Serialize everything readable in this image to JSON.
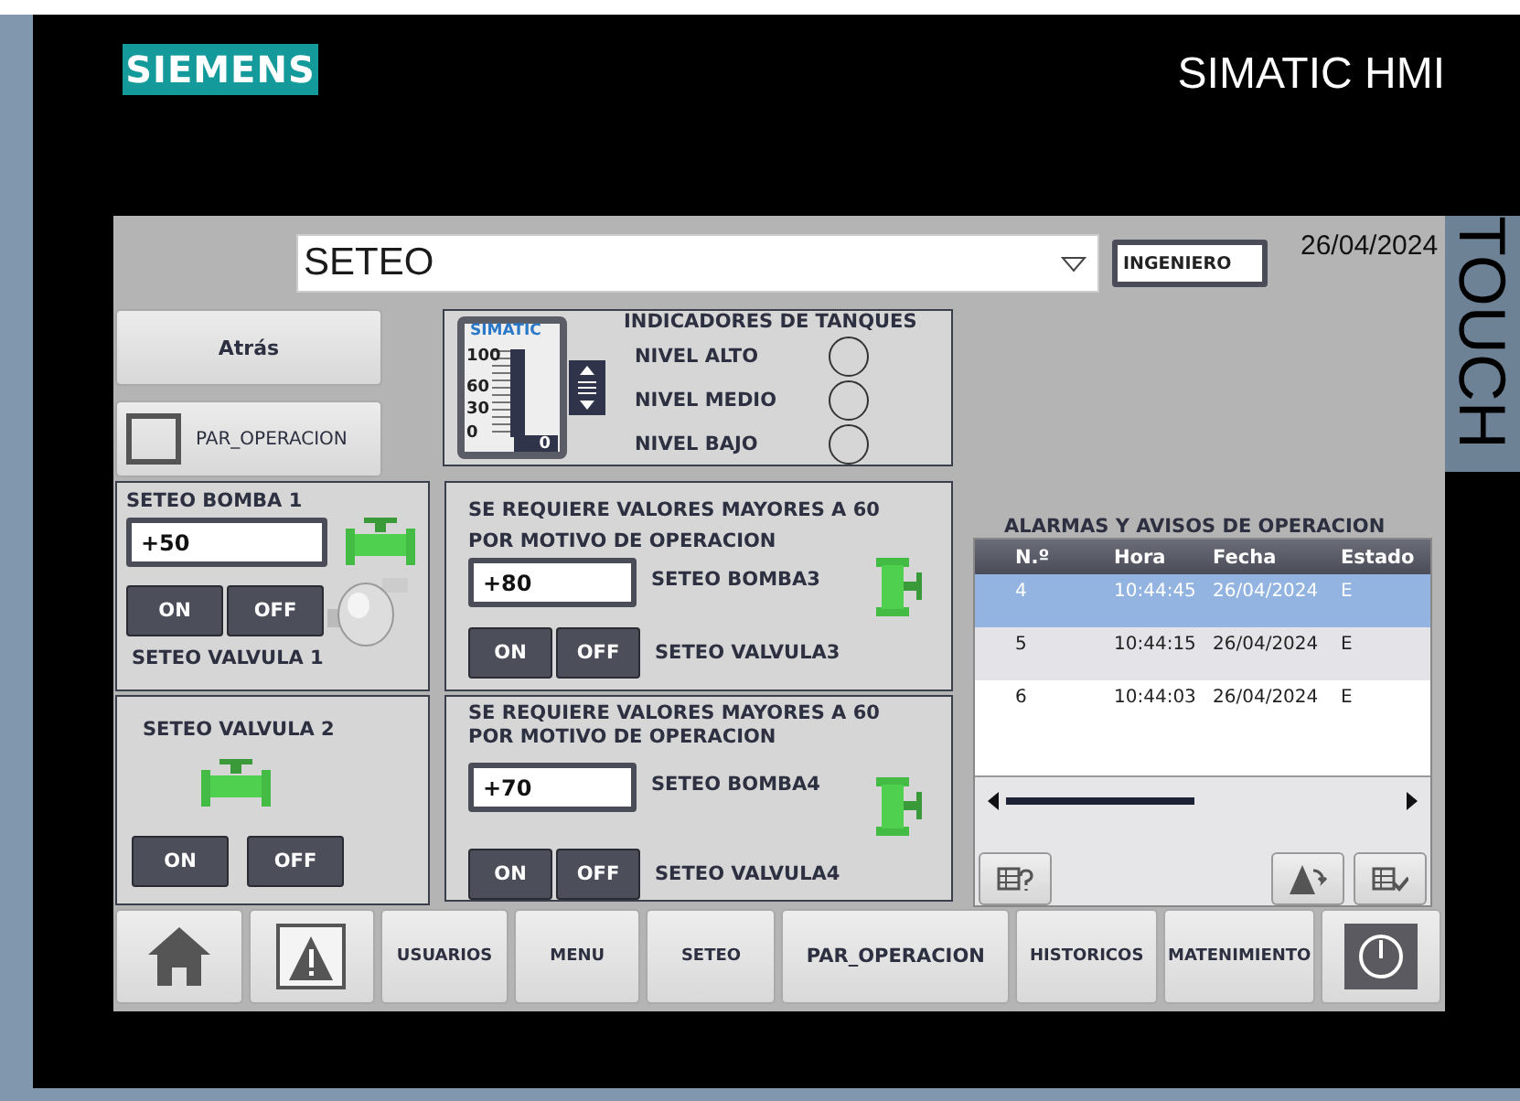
{
  "brand": {
    "logo": "SIEMENS",
    "product": "SIMATIC HMI",
    "side_label": "TOUCH"
  },
  "header": {
    "screen_title": "SETEO",
    "user": "INGENIERO",
    "date": "26/04/2024"
  },
  "left_buttons": [
    {
      "kind": "button",
      "label": "Atrás"
    },
    {
      "kind": "checkbox",
      "label": "PAR_OPERACION",
      "checked": false
    }
  ],
  "tanks": {
    "title": "INDICADORES DE TANQUES",
    "gauge_brand": "SIMATIC",
    "gauge_ticks": [
      "100",
      "60",
      "30",
      "0"
    ],
    "gauge_value": "0",
    "levels": [
      {
        "label": "NIVEL ALTO",
        "on": false
      },
      {
        "label": "NIVEL MEDIO",
        "on": false
      },
      {
        "label": "NIVEL BAJO",
        "on": false
      }
    ]
  },
  "pump1": {
    "title": "SETEO BOMBA 1",
    "value": "+50",
    "on_label": "ON",
    "off_label": "OFF",
    "valve_label": "SETEO VALVULA 1"
  },
  "valve2": {
    "title": "SETEO VALVULA 2",
    "on_label": "ON",
    "off_label": "OFF"
  },
  "pump_panels": [
    {
      "notice": "SE REQUIERE VALORES MAYORES A 60",
      "notice2": "POR MOTIVO DE OPERACION",
      "value": "+80",
      "pump_label": "SETEO BOMBA3",
      "on_label": "ON",
      "off_label": "OFF",
      "valve_label": "SETEO VALVULA3"
    },
    {
      "notice": "SE REQUIERE VALORES MAYORES A 60",
      "notice2": "POR MOTIVO DE OPERACION",
      "value": "+70",
      "pump_label": "SETEO BOMBA4",
      "on_label": "ON",
      "off_label": "OFF",
      "valve_label": "SETEO VALVULA4"
    }
  ],
  "alarms": {
    "title": "ALARMAS Y AVISOS DE OPERACION",
    "columns": [
      "N.º",
      "Hora",
      "Fecha",
      "Estado"
    ],
    "rows": [
      {
        "cells": [
          "4",
          "10:44:45",
          "26/04/2024",
          "E"
        ],
        "selected": true
      },
      {
        "cells": [
          "5",
          "10:44:15",
          "26/04/2024",
          "E"
        ],
        "selected": false
      },
      {
        "cells": [
          "6",
          "10:44:03",
          "26/04/2024",
          "E"
        ],
        "selected": false
      }
    ]
  },
  "nav": [
    {
      "kind": "home"
    },
    {
      "kind": "alarm"
    },
    {
      "kind": "text",
      "label": "USUARIOS"
    },
    {
      "kind": "text",
      "label": "MENU"
    },
    {
      "kind": "text",
      "label": "SETEO"
    },
    {
      "kind": "text",
      "label": "PAR_OPERACION"
    },
    {
      "kind": "text",
      "label": "HISTORICOS"
    },
    {
      "kind": "text",
      "label": "MATENIMIENTO"
    },
    {
      "kind": "power"
    }
  ]
}
